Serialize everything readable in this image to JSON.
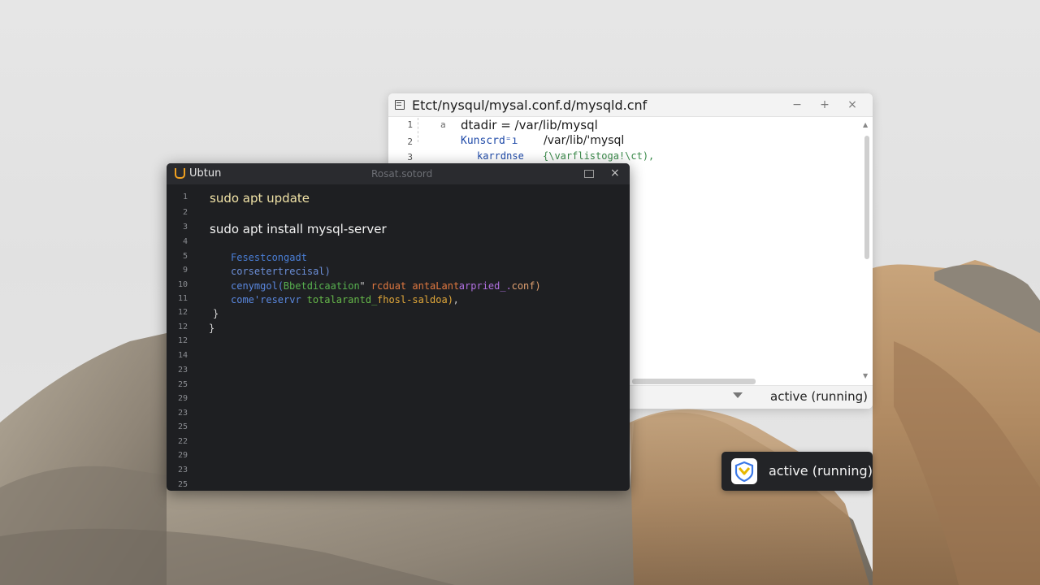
{
  "editor": {
    "title": "Etct/nysqul/mysal.conf.d/mysqld.cnf",
    "controls": {
      "minimize": "−",
      "maximize": "+",
      "close": "×"
    },
    "line_numbers": [
      "1",
      "2",
      "3"
    ],
    "lines": [
      {
        "prefix": "a",
        "text": "dtadir = /var/lib/mysql",
        "color": "#1a1a1a"
      },
      {
        "key": "Kunscrd⁼ı",
        "value": "/var/lib/'mysql",
        "key_color": "#1f4aa8",
        "value_color": "#1a1a1a"
      },
      {
        "key": "karrdnse",
        "value": "{\\varflistoga!\\ct),",
        "key_color": "#1f4aa8",
        "value_color": "#3a8a4a"
      }
    ],
    "status": "active (running)"
  },
  "terminal": {
    "app_title": "Ubtun",
    "tab_title": "Rosat.sotord",
    "controls": {
      "maximize": "□",
      "close": "×"
    },
    "line_numbers": [
      "1",
      "2",
      "3",
      "4",
      "5",
      "9",
      "10",
      "11",
      "12",
      "12",
      "12",
      "14",
      "23",
      "25",
      "29",
      "23",
      "25",
      "22",
      "29",
      "23",
      "25"
    ],
    "commands": [
      {
        "text": "sudo apt update",
        "color": "#f0e2a6"
      },
      {
        "text": "sudo apt install mysql-server",
        "color": "#f2f2f2"
      }
    ],
    "code": [
      {
        "segments": [
          {
            "text": "Fesestcongadt",
            "color": "#4a7ed6"
          }
        ]
      },
      {
        "segments": [
          {
            "text": "corsetertrecisal)",
            "color": "#6c8fd8"
          }
        ]
      },
      {
        "segments": [
          {
            "text": "cenymgol(",
            "color": "#5a88e0"
          },
          {
            "text": "Bbetdicaation",
            "color": "#57b04f"
          },
          {
            "text": " \"",
            "color": "#c9c9c9"
          },
          {
            "text": "rcduat antaLant",
            "color": "#e07840"
          },
          {
            "text": "arpried_.",
            "color": "#b070e0"
          },
          {
            "text": "conf)",
            "color": "#e0a070"
          }
        ]
      },
      {
        "segments": [
          {
            "text": "come'reservr ",
            "color": "#5a88e0"
          },
          {
            "text": "totalarantd_",
            "color": "#66b84a"
          },
          {
            "text": "fhosl-saldoa)",
            "color": "#e2a83a"
          },
          {
            "text": ",",
            "color": "#c9c9c9"
          }
        ]
      },
      {
        "segments": [
          {
            "text": "}",
            "color": "#d9d9d9"
          }
        ]
      },
      {
        "segments": [
          {
            "text": "}",
            "color": "#d9d9d9"
          }
        ]
      }
    ]
  },
  "toast": {
    "icon": "service-shield-icon",
    "text": "active (running)",
    "accent": "#e8b800",
    "accent2": "#3b78e7"
  }
}
